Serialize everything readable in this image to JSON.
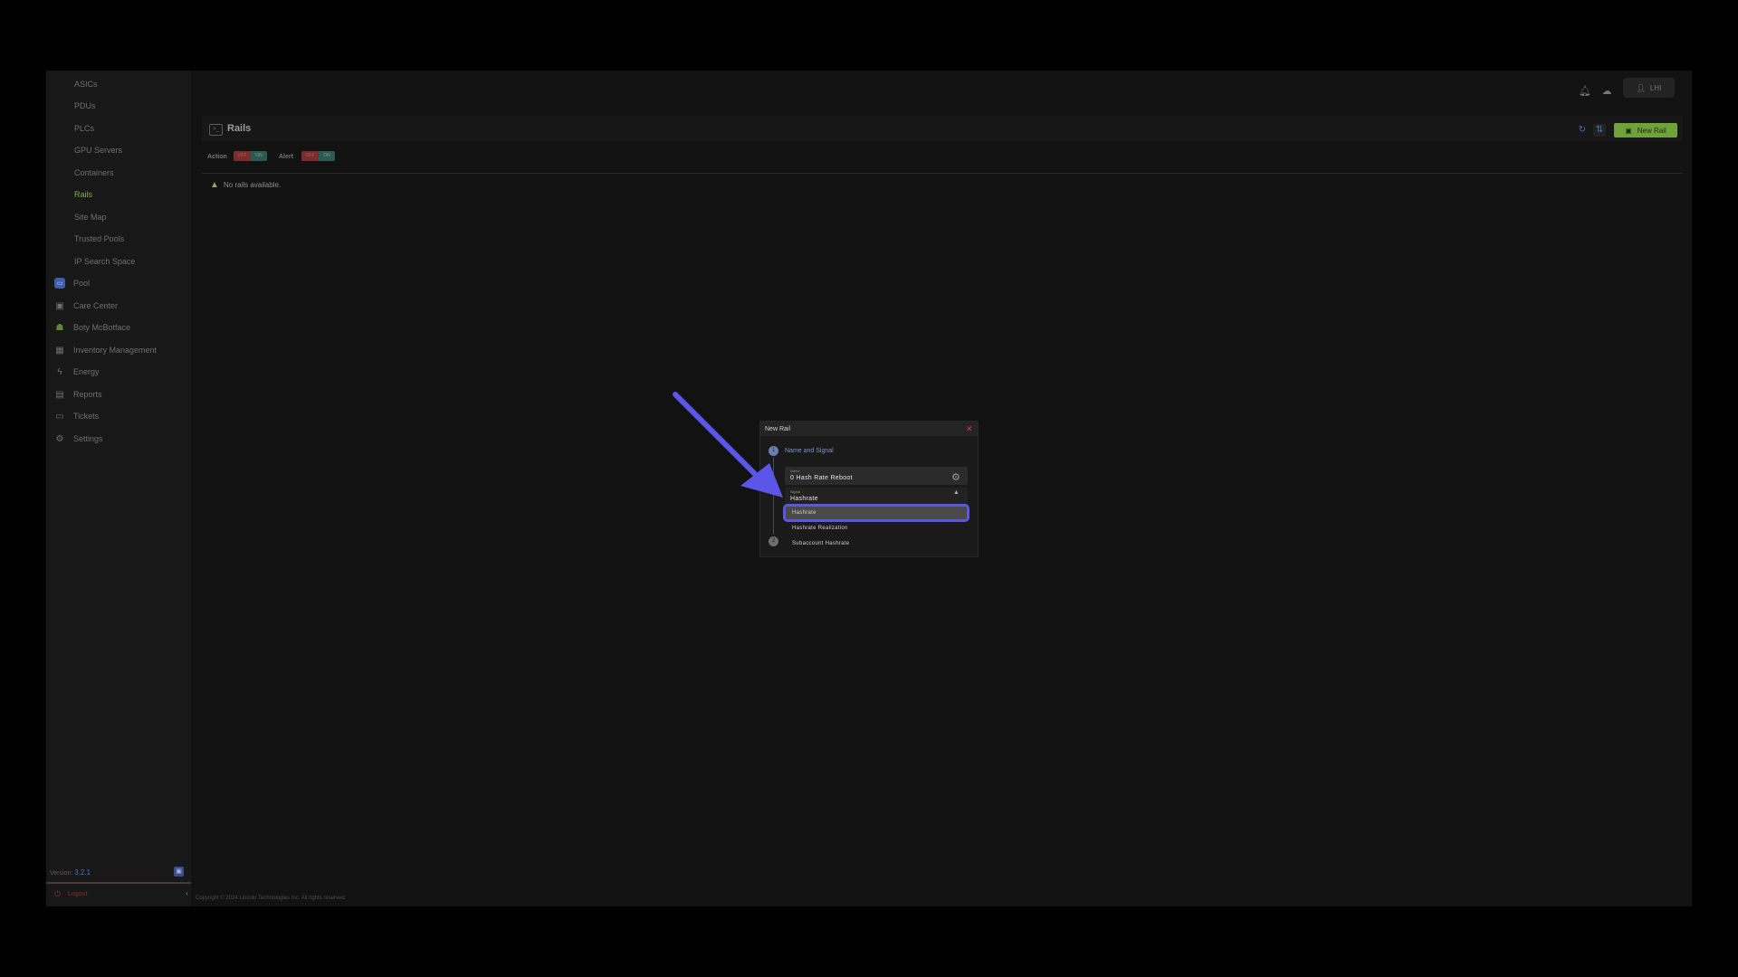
{
  "sidebar": {
    "sub_items": [
      "ASICs",
      "PDUs",
      "PLCs",
      "GPU Servers",
      "Containers",
      "Rails",
      "Site Map",
      "Trusted Pools",
      "IP Search Space"
    ],
    "active_sub_item": "Rails",
    "top_items": [
      {
        "label": "Pool",
        "icon": "pool-icon"
      },
      {
        "label": "Care Center",
        "icon": "care-center-icon"
      },
      {
        "label": "Boty McBotface",
        "icon": "robot-icon"
      },
      {
        "label": "Inventory Management",
        "icon": "inventory-icon"
      },
      {
        "label": "Energy",
        "icon": "lightning-icon"
      },
      {
        "label": "Reports",
        "icon": "document-icon"
      },
      {
        "label": "Tickets",
        "icon": "ticket-icon"
      },
      {
        "label": "Settings",
        "icon": "gear-icon"
      }
    ],
    "version_label": "Version:",
    "version_value": "3.2.1",
    "logout_label": "Logout"
  },
  "header": {
    "user_label": "LHI"
  },
  "page": {
    "title": "Rails",
    "new_rail_label": "New Rail",
    "action_label": "Action",
    "alert_label": "Alert",
    "toggle_off": "OFF",
    "toggle_on": "ON",
    "empty_message": "No rails available."
  },
  "footer": {
    "copyright": "Copyright © 2024 Lincoln Technologies Inc. All rights reserved."
  },
  "modal": {
    "title": "New Rail",
    "step1_number": "1",
    "step2_number": "2",
    "step1_label": "Name and Signal",
    "name_field_label": "Name",
    "name_field_value": "0 Hash Rate Reboot",
    "signal_field_label": "Signal",
    "signal_field_value": "Hashrate",
    "signal_options": [
      "Hashrate",
      "Hashrate Realization",
      "Subaccount Hashrate"
    ]
  },
  "colors": {
    "accent_green": "#6fa33a",
    "highlight_purple": "#5b55e8",
    "close_red": "#c84444"
  }
}
